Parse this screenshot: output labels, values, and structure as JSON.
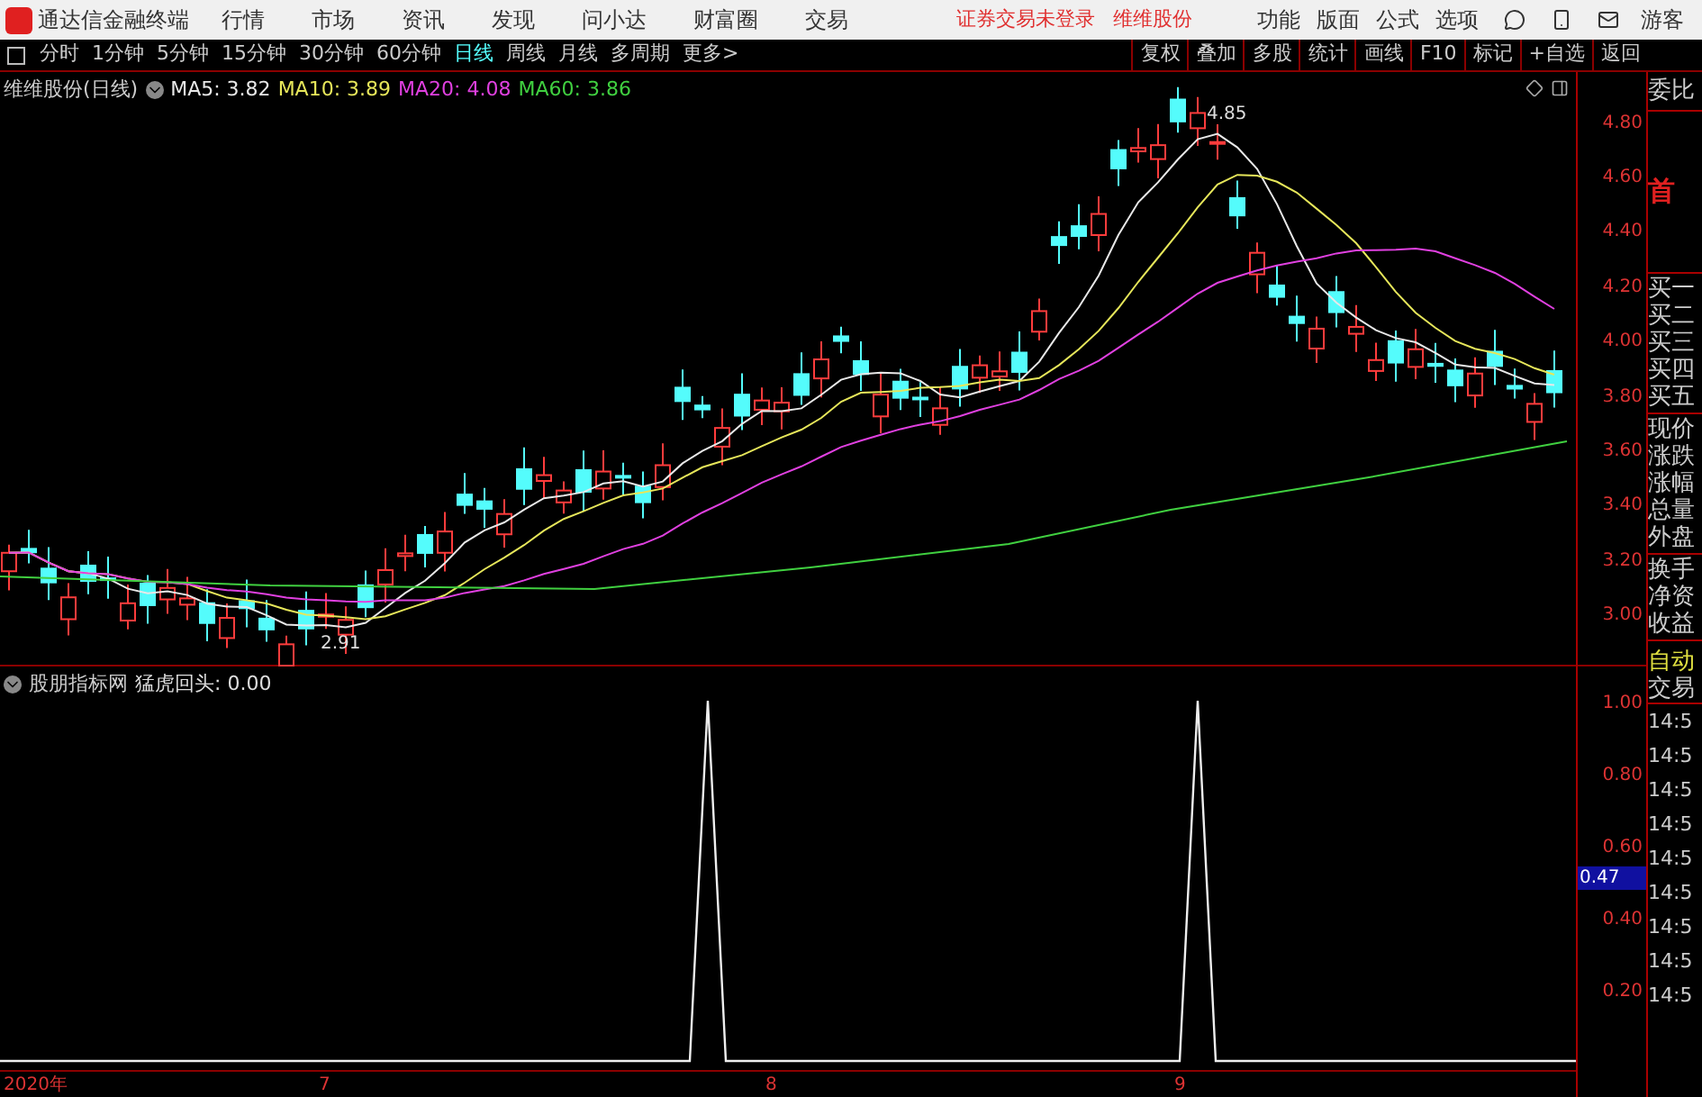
{
  "app": {
    "title": "通达信金融终端"
  },
  "menu": [
    "行情",
    "市场",
    "资讯",
    "发现",
    "问小达",
    "财富圈",
    "交易"
  ],
  "notices": [
    "证券交易未登录",
    "维维股份"
  ],
  "tools": [
    "功能",
    "版面",
    "公式",
    "选项"
  ],
  "user": "游客",
  "periods": [
    {
      "label": "分时",
      "selected": false
    },
    {
      "label": "1分钟",
      "selected": false
    },
    {
      "label": "5分钟",
      "selected": false
    },
    {
      "label": "15分钟",
      "selected": false
    },
    {
      "label": "30分钟",
      "selected": false
    },
    {
      "label": "60分钟",
      "selected": false
    },
    {
      "label": "日线",
      "selected": true
    },
    {
      "label": "周线",
      "selected": false
    },
    {
      "label": "月线",
      "selected": false
    },
    {
      "label": "多周期",
      "selected": false
    },
    {
      "label": "更多>",
      "selected": false
    }
  ],
  "actions": [
    "复权",
    "叠加",
    "多股",
    "统计",
    "画线",
    "F10",
    "标记",
    "+自选",
    "返回"
  ],
  "main_chart": {
    "title": "维维股份(日线)",
    "ma": [
      {
        "label": "MA5: 3.82",
        "color": "#e8e8e8"
      },
      {
        "label": "MA10: 3.89",
        "color": "#e6e65a"
      },
      {
        "label": "MA20: 4.08",
        "color": "#e040e0"
      },
      {
        "label": "MA60: 3.86",
        "color": "#40d040"
      }
    ],
    "high_label": "4.85",
    "low_label": "2.91",
    "y_ticks": [
      "4.80",
      "4.60",
      "4.40",
      "4.20",
      "4.00",
      "3.80",
      "3.60",
      "3.40",
      "3.20",
      "3.00"
    ]
  },
  "indicator": {
    "name": "股朋指标网",
    "reading": "猛虎回头: 0.00",
    "y_ticks": [
      "1.00",
      "0.80",
      "0.60",
      "0.40",
      "0.20"
    ],
    "cursor_value": "0.47"
  },
  "x_axis": [
    "2020年",
    "7",
    "8",
    "9"
  ],
  "side_panel": {
    "header": "委比",
    "badge": "首",
    "quote_rows": [
      [
        "买一",
        "买二",
        "买三",
        "买四",
        "买五"
      ],
      [
        "现价",
        "涨跌",
        "涨幅",
        "总量",
        "外盘"
      ],
      [
        "换手",
        "净资",
        "收益"
      ]
    ],
    "mode": "自动",
    "trades_title": "交易",
    "trade_times": [
      "14:5",
      "14:5",
      "14:5",
      "14:5",
      "14:5",
      "14:5",
      "14:5",
      "14:5",
      "14:5"
    ]
  }
}
